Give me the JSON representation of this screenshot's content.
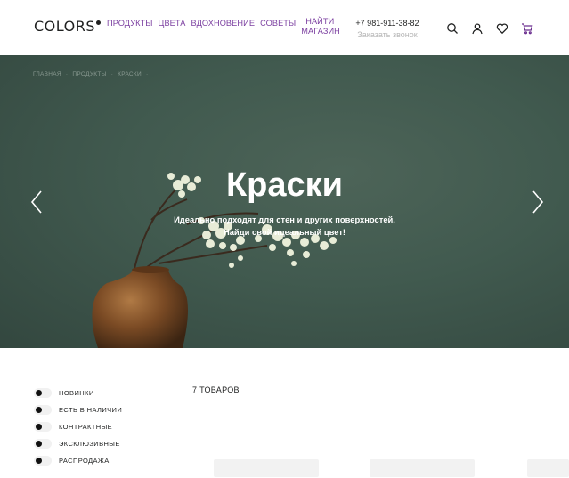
{
  "header": {
    "logo": "COLORS",
    "nav": [
      {
        "label": "ПРОДУКТЫ"
      },
      {
        "label": "ЦВЕТА"
      },
      {
        "label": "ВДОХНОВЕНИЕ"
      },
      {
        "label": "СОВЕТЫ"
      }
    ],
    "nav_two_line": {
      "line1": "НАЙТИ",
      "line2": "МАГАЗИН"
    },
    "phone": "+7 981-911-38-82",
    "callback": "Заказать звонок",
    "icons": [
      "search-icon",
      "user-icon",
      "heart-icon",
      "cart-icon"
    ],
    "accent_color": "#7b3fa0"
  },
  "hero": {
    "breadcrumbs": [
      "ГЛАВНАЯ",
      "·",
      "ПРОДУКТЫ",
      "·",
      "КРАСКИ",
      "·"
    ],
    "title": "Краски",
    "subtitle_line1": "Идеально подходят для стен и других поверхностей.",
    "subtitle_line2": "Найди свой идеальный цвет!",
    "background_color": "#415a4f"
  },
  "filters": [
    {
      "label": "НОВИНКИ"
    },
    {
      "label": "ЕСТЬ В НАЛИЧИИ"
    },
    {
      "label": "КОНТРАКТНЫЕ"
    },
    {
      "label": "ЭКСКЛЮЗИВНЫЕ"
    },
    {
      "label": "РАСПРОДАЖА"
    }
  ],
  "products": {
    "count_label": "7 ТОВАРОВ"
  }
}
